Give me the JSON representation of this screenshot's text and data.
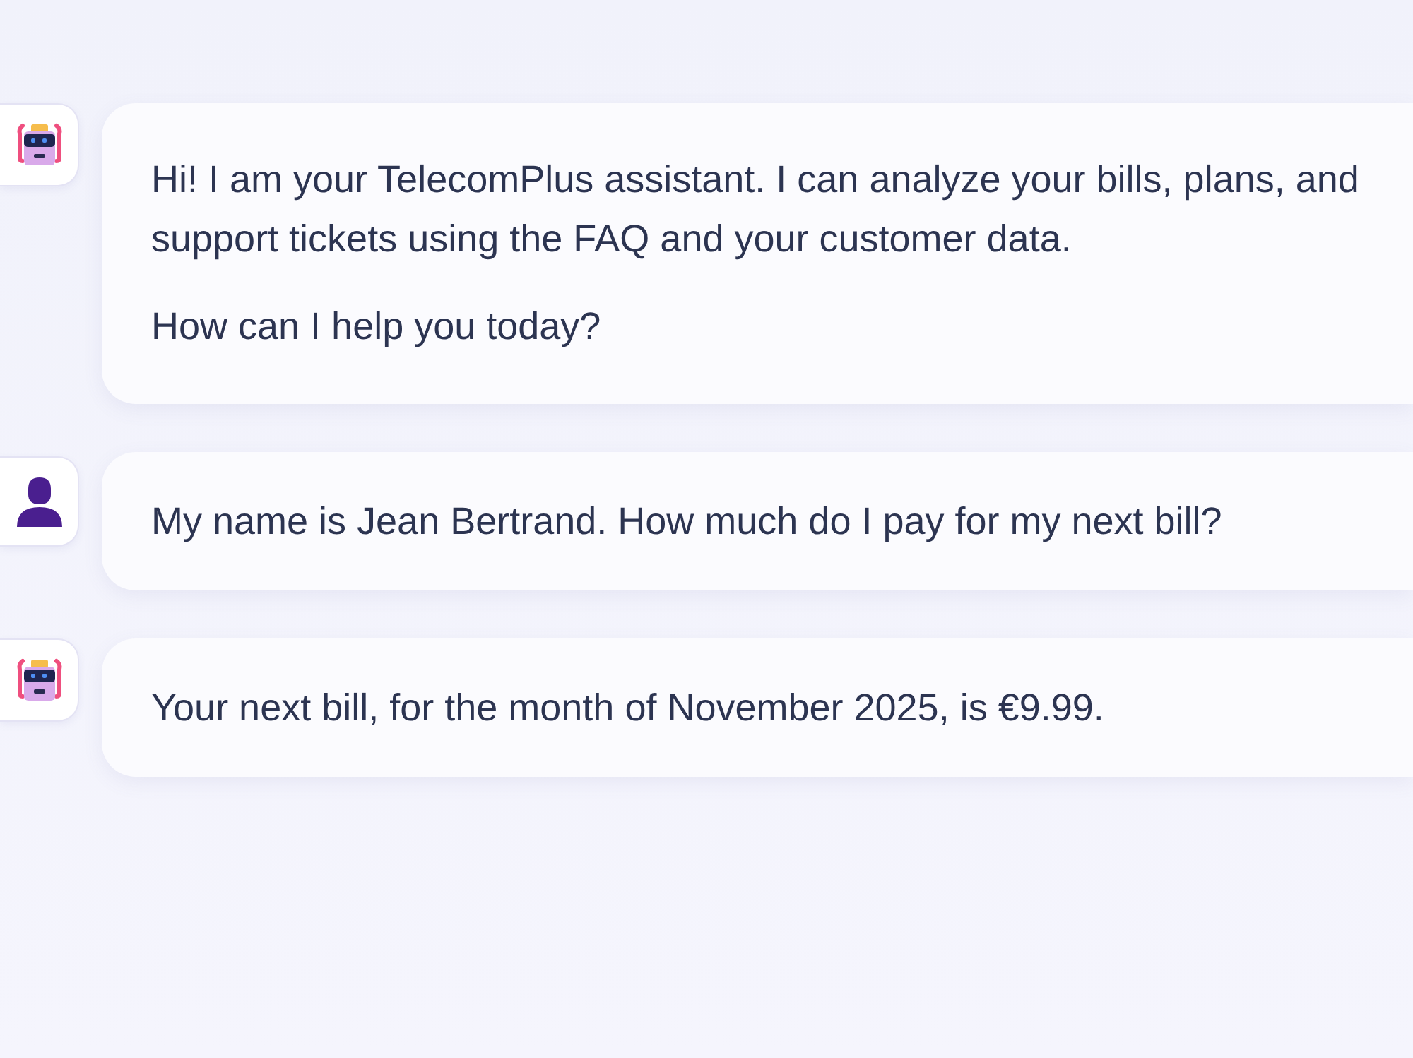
{
  "messages": [
    {
      "kind": "assistant",
      "paragraphs": [
        "Hi! I am your TelecomPlus assistant. I can analyze your bills, plans, and support tickets using the FAQ and your customer data.",
        "How can I help you today?"
      ]
    },
    {
      "kind": "user",
      "paragraphs": [
        "My name is Jean Bertrand. How much do I pay for my next bill?"
      ]
    },
    {
      "kind": "assistant",
      "paragraphs": [
        "Your next bill, for the month of November 2025, is €9.99."
      ]
    }
  ]
}
